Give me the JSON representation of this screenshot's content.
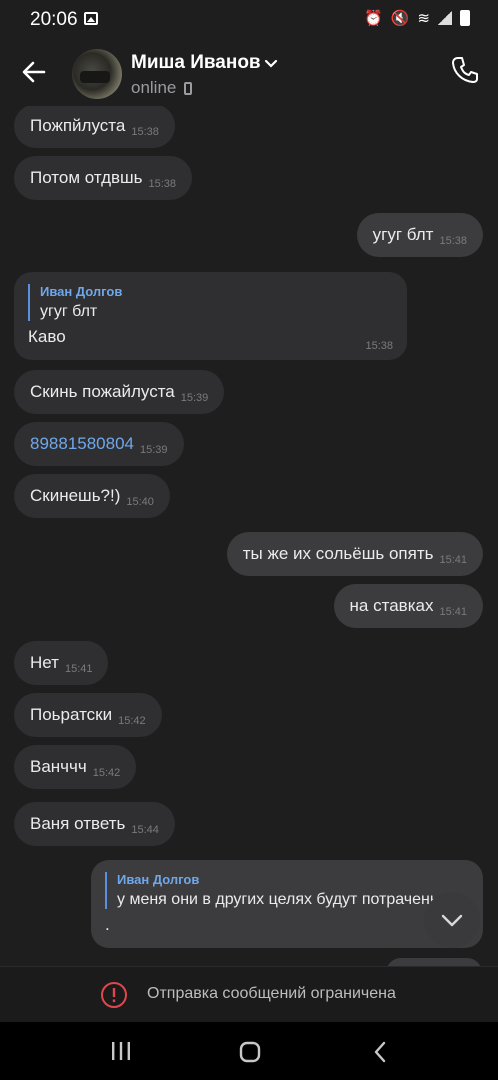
{
  "status_bar": {
    "time": "20:06"
  },
  "header": {
    "name": "Миша Иванов",
    "status": "online"
  },
  "messages": [
    {
      "text": "Пожпйлуста",
      "time": "15:38"
    },
    {
      "text": "Потом отдвшь",
      "time": "15:38"
    },
    {
      "text": "угуг блт",
      "time": "15:38"
    },
    {
      "reply_author": "Иван Долгов",
      "reply_text": "угуг блт",
      "text": "Каво",
      "time": "15:38"
    },
    {
      "text": "Скинь пожайлуста",
      "time": "15:39"
    },
    {
      "text": "89881580804",
      "time": "15:39"
    },
    {
      "text": "Скинешь?!)",
      "time": "15:40"
    },
    {
      "text": "ты же их сольёшь опять",
      "time": "15:41"
    },
    {
      "text": "на ставках",
      "time": "15:41"
    },
    {
      "text": "Нет",
      "time": "15:41"
    },
    {
      "text": "Поьратски",
      "time": "15:42"
    },
    {
      "text": "Ванччч",
      "time": "15:42"
    },
    {
      "text": "Ваня ответь",
      "time": "15:44"
    },
    {
      "reply_author": "Иван Долгов",
      "reply_text": "у меня они в других целях будут потрачены",
      "text": "."
    }
  ],
  "restriction": {
    "text": "Отправка сообщений ограничена"
  },
  "colors": {
    "background": "#1e1e1f",
    "incoming": "#2f2f31",
    "outgoing": "#3c3c3f",
    "link": "#6fa8ea",
    "warning": "#e0474c"
  },
  "icons": [
    "back-arrow-icon",
    "chevron-down-icon",
    "phone-icon",
    "scroll-down-icon",
    "warning-icon",
    "recent-apps-icon",
    "home-icon",
    "nav-back-icon"
  ]
}
